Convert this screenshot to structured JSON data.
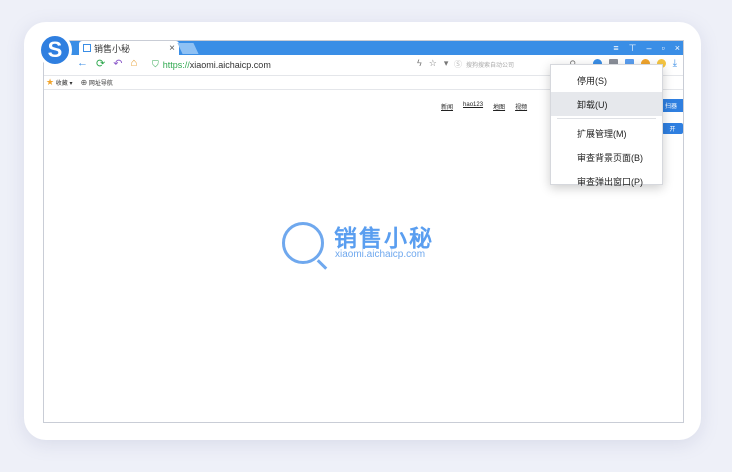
{
  "browser": {
    "tab_title": "销售小秘",
    "tab_close": "×",
    "window_controls": [
      "≡",
      "⊤",
      "–",
      "▫",
      "×"
    ],
    "url_scheme": "https://",
    "url_host": "xiaomi.aichaicp.com",
    "search_placeholder": "搜狗搜索自动公司",
    "bookmarks": {
      "favorites_label": "收藏",
      "favorites_arrow": "▾",
      "nav_label": "网址导航"
    }
  },
  "page": {
    "top_links": [
      "新闻",
      "hao123",
      "地图",
      "视频"
    ],
    "brand_name": "销售小秘",
    "brand_domain": "xiaomi.aichaicp.com",
    "right_btn_1": "扫器",
    "right_btn_2": "开"
  },
  "context_menu": {
    "items": [
      {
        "label": "停用(S)"
      },
      {
        "label": "卸载(U)"
      },
      {
        "label": "扩展管理(M)"
      },
      {
        "label": "审查背景页面(B)"
      },
      {
        "label": "审查弹出窗口(P)"
      }
    ]
  },
  "colors": {
    "accent": "#3a8ee6",
    "brand": "#5a9ef0",
    "secure": "#2fa84f"
  }
}
